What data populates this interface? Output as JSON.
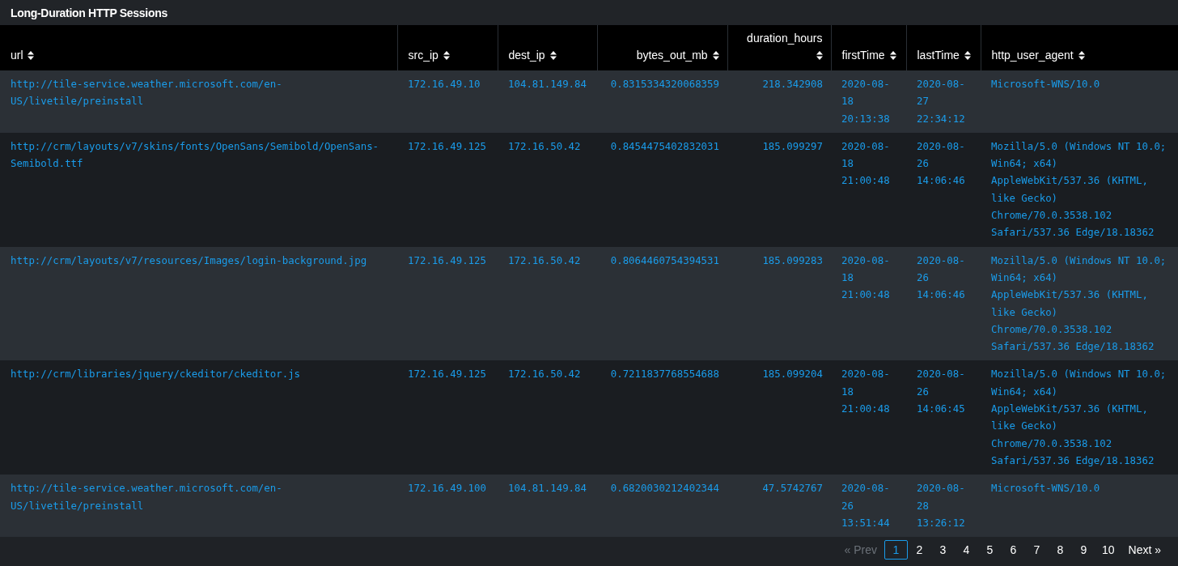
{
  "panel": {
    "title": "Long-Duration HTTP Sessions"
  },
  "table": {
    "columns": [
      {
        "label": "url",
        "kind": "text"
      },
      {
        "label": "src_ip",
        "kind": "text"
      },
      {
        "label": "dest_ip",
        "kind": "text"
      },
      {
        "label": "bytes_out_mb",
        "kind": "number"
      },
      {
        "label": "duration_hours",
        "kind": "number"
      },
      {
        "label": "firstTime",
        "kind": "text"
      },
      {
        "label": "lastTime",
        "kind": "text"
      },
      {
        "label": "http_user_agent",
        "kind": "text"
      }
    ],
    "rows": [
      {
        "cells": [
          "http://tile-service.weather.microsoft.com/en-US/livetile/preinstall",
          "172.16.49.10",
          "104.81.149.84",
          "0.8315334320068359",
          "218.342908",
          "2020-08-18 20:13:38",
          "2020-08-27 22:34:12",
          "Microsoft-WNS/10.0"
        ]
      },
      {
        "cells": [
          "http://crm/layouts/v7/skins/fonts/OpenSans/Semibold/OpenSans-Semibold.ttf",
          "172.16.49.125",
          "172.16.50.42",
          "0.8454475402832031",
          "185.099297",
          "2020-08-18 21:00:48",
          "2020-08-26 14:06:46",
          "Mozilla/5.0 (Windows NT 10.0; Win64; x64) AppleWebKit/537.36 (KHTML, like Gecko) Chrome/70.0.3538.102 Safari/537.36 Edge/18.18362"
        ]
      },
      {
        "cells": [
          "http://crm/layouts/v7/resources/Images/login-background.jpg",
          "172.16.49.125",
          "172.16.50.42",
          "0.8064460754394531",
          "185.099283",
          "2020-08-18 21:00:48",
          "2020-08-26 14:06:46",
          "Mozilla/5.0 (Windows NT 10.0; Win64; x64) AppleWebKit/537.36 (KHTML, like Gecko) Chrome/70.0.3538.102 Safari/537.36 Edge/18.18362"
        ]
      },
      {
        "cells": [
          "http://crm/libraries/jquery/ckeditor/ckeditor.js",
          "172.16.49.125",
          "172.16.50.42",
          "0.7211837768554688",
          "185.099204",
          "2020-08-18 21:00:48",
          "2020-08-26 14:06:45",
          "Mozilla/5.0 (Windows NT 10.0; Win64; x64) AppleWebKit/537.36 (KHTML, like Gecko) Chrome/70.0.3538.102 Safari/537.36 Edge/18.18362"
        ]
      },
      {
        "cells": [
          "http://tile-service.weather.microsoft.com/en-US/livetile/preinstall",
          "172.16.49.100",
          "104.81.149.84",
          "0.6820030212402344",
          "47.5742767",
          "2020-08-26 13:51:44",
          "2020-08-28 13:26:12",
          "Microsoft-WNS/10.0"
        ]
      }
    ]
  },
  "pagination": {
    "prev": {
      "label": "« Prev",
      "disabled": true
    },
    "pages": [
      {
        "label": "1",
        "selected": true
      },
      {
        "label": "2",
        "selected": false
      },
      {
        "label": "3",
        "selected": false
      },
      {
        "label": "4",
        "selected": false
      },
      {
        "label": "5",
        "selected": false
      },
      {
        "label": "6",
        "selected": false
      },
      {
        "label": "7",
        "selected": false
      },
      {
        "label": "8",
        "selected": false
      },
      {
        "label": "9",
        "selected": false
      },
      {
        "label": "10",
        "selected": false
      }
    ],
    "next": {
      "label": "Next »",
      "disabled": false
    }
  }
}
